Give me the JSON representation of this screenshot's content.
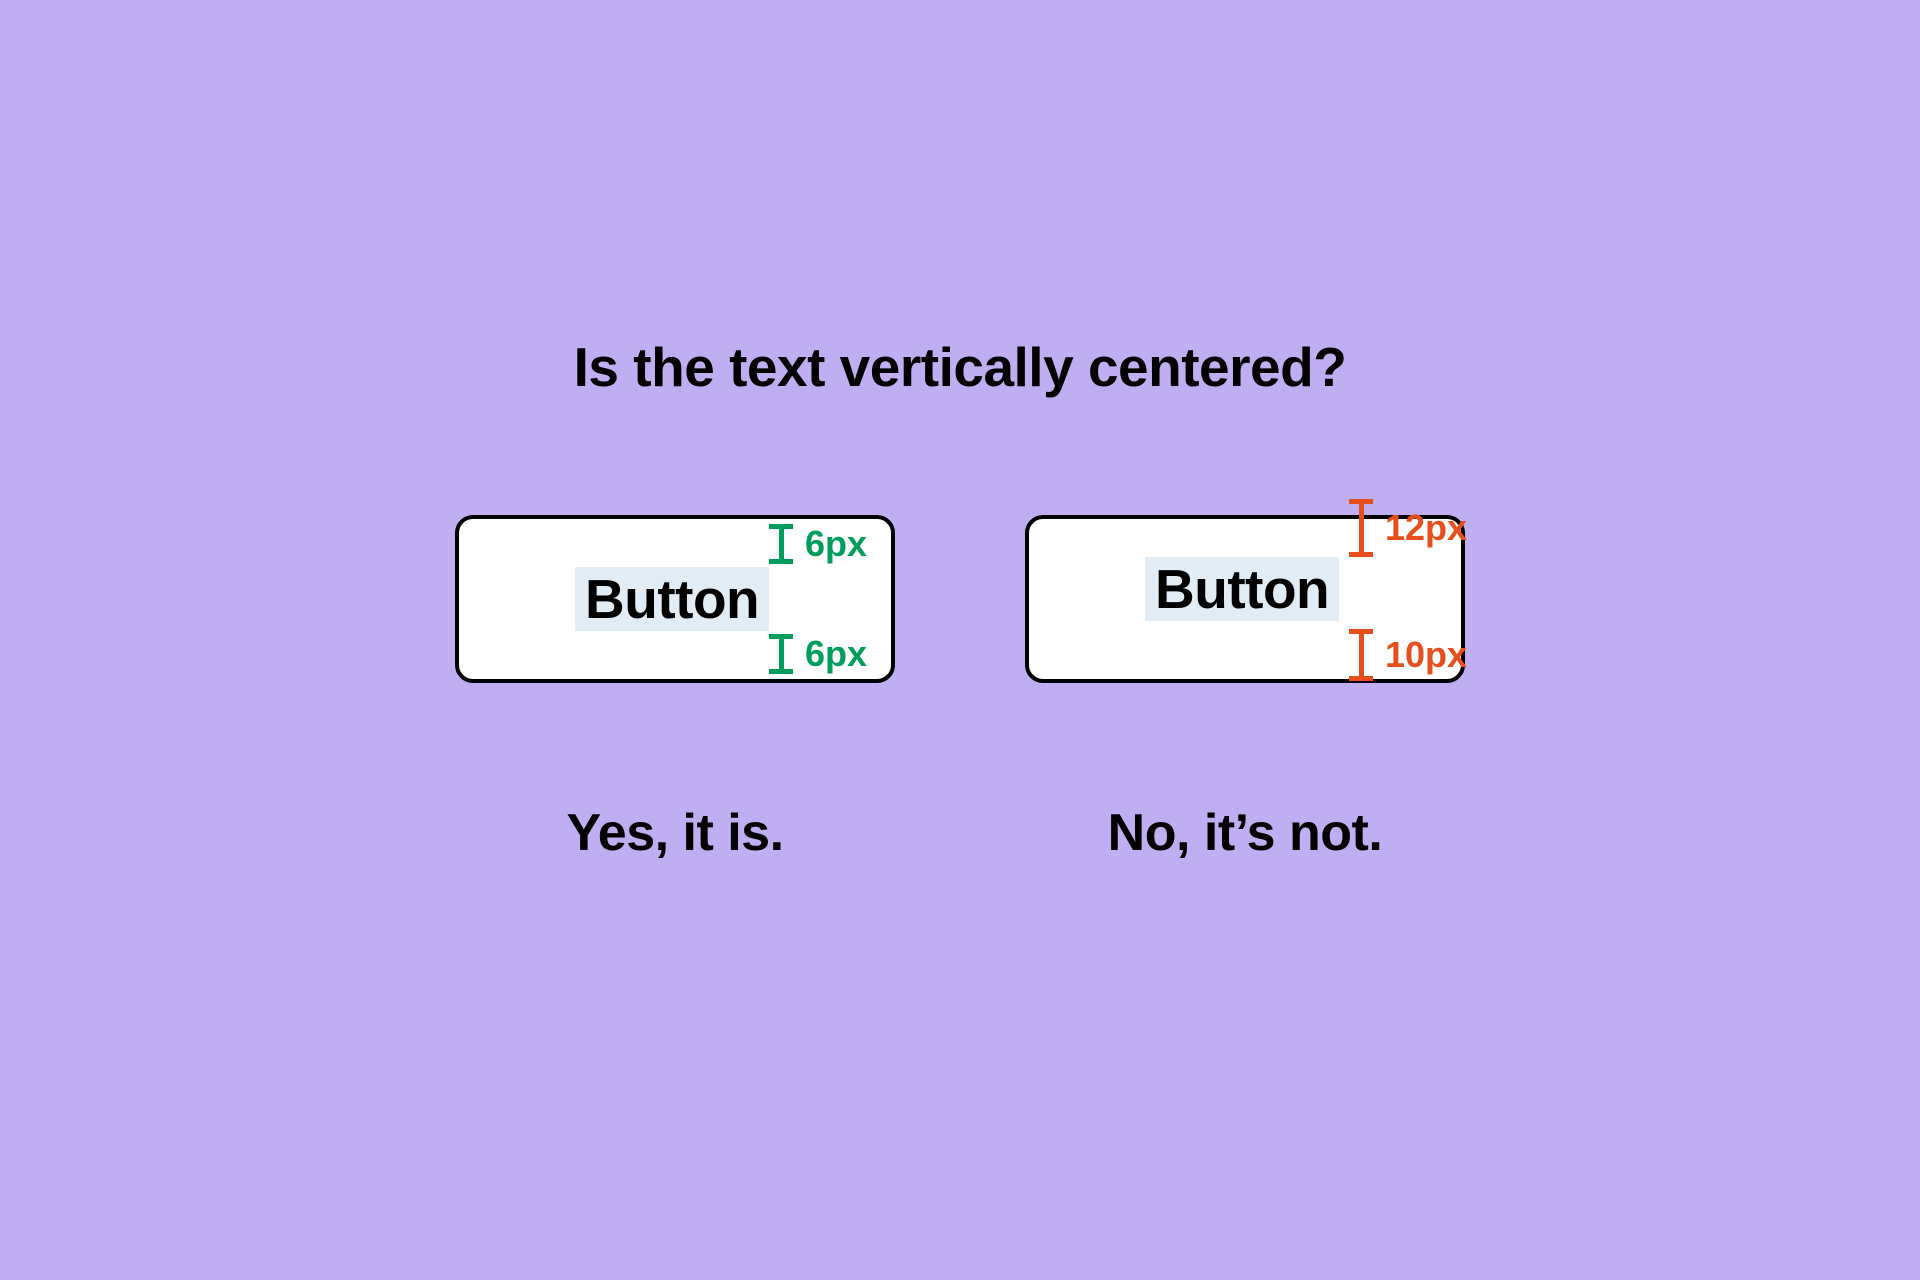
{
  "title": "Is the text vertically centered?",
  "left": {
    "button_text": "Button",
    "top_measure": "6px",
    "bottom_measure": "6px",
    "caption": "Yes, it is.",
    "color": "green"
  },
  "right": {
    "button_text": "Button",
    "top_measure": "12px",
    "bottom_measure": "10px",
    "caption": "No, it’s not.",
    "color": "orange"
  },
  "colors": {
    "background": "#BFAFF2",
    "correct": "#009E5C",
    "incorrect": "#E84E1C",
    "highlight": "#E2ECF5"
  }
}
